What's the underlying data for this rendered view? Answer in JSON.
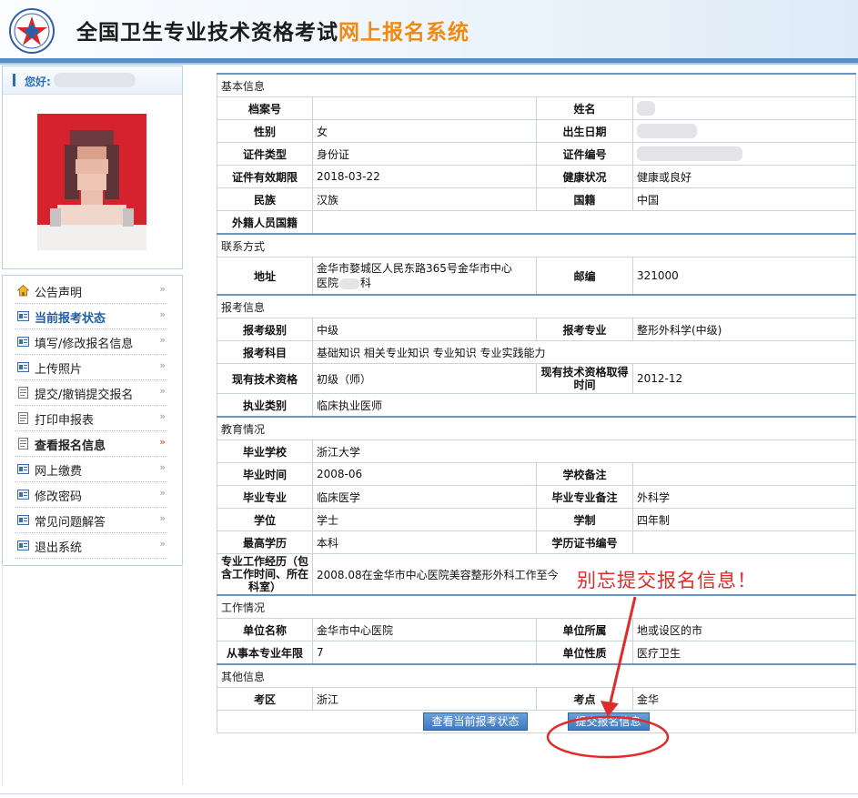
{
  "header": {
    "title_main": "全国卫生专业技术资格考试",
    "title_accent": "网上报名系统"
  },
  "sidebar": {
    "greeting": "您好:",
    "nav": [
      {
        "label": "公告声明",
        "icon": "home-icon"
      },
      {
        "label": "当前报考状态",
        "icon": "card-icon",
        "active": true
      },
      {
        "label": "填写/修改报名信息",
        "icon": "card-icon"
      },
      {
        "label": "上传照片",
        "icon": "card-icon"
      },
      {
        "label": "提交/撤销提交报名",
        "icon": "document-icon"
      },
      {
        "label": "打印申报表",
        "icon": "document-icon"
      },
      {
        "label": "查看报名信息",
        "icon": "document-icon",
        "current": true
      },
      {
        "label": "网上缴费",
        "icon": "card-icon"
      },
      {
        "label": "修改密码",
        "icon": "card-icon"
      },
      {
        "label": "常见问题解答",
        "icon": "card-icon"
      },
      {
        "label": "退出系统",
        "icon": "card-icon"
      }
    ]
  },
  "form": {
    "basic": {
      "title": "基本信息",
      "archive_no_label": "档案号",
      "archive_no": "",
      "name_label": "姓名",
      "gender_label": "性别",
      "gender": "女",
      "birth_label": "出生日期",
      "id_type_label": "证件类型",
      "id_type": "身份证",
      "id_no_label": "证件编号",
      "id_valid_label": "证件有效期限",
      "id_valid": "2018-03-22",
      "health_label": "健康状况",
      "health": "健康或良好",
      "ethnicity_label": "民族",
      "ethnicity": "汉族",
      "nationality_label": "国籍",
      "nationality": "中国",
      "foreign_label": "外籍人员国籍",
      "foreign": ""
    },
    "contact": {
      "title": "联系方式",
      "address_label": "地址",
      "address_line1": "金华市婺城区人民东路365号金华市中心",
      "address_line2a": "医院",
      "address_line2b": "科",
      "postcode_label": "邮编",
      "postcode": "321000"
    },
    "exam": {
      "title": "报考信息",
      "level_label": "报考级别",
      "level": "中级",
      "specialty_label": "报考专业",
      "specialty": "整形外科学(中级)",
      "subjects_label": "报考科目",
      "subjects": "基础知识 相关专业知识 专业知识 专业实践能力",
      "current_qual_label": "现有技术资格",
      "current_qual": "初级（师）",
      "qual_time_label": "现有技术资格取得时间",
      "qual_time": "2012-12",
      "practice_label": "执业类别",
      "practice": "临床执业医师"
    },
    "education": {
      "title": "教育情况",
      "school_label": "毕业学校",
      "school": "浙江大学",
      "grad_time_label": "毕业时间",
      "grad_time": "2008-06",
      "school_note_label": "学校备注",
      "school_note": "",
      "major_label": "毕业专业",
      "major": "临床医学",
      "major_note_label": "毕业专业备注",
      "major_note": "外科学",
      "degree_label": "学位",
      "degree": "学士",
      "duration_label": "学制",
      "duration": "四年制",
      "highest_label": "最高学历",
      "highest": "本科",
      "cert_label": "学历证书编号",
      "cert": "",
      "experience_label": "专业工作经历（包含工作时间、所在科室）",
      "experience": "2008.08在金华市中心医院美容整形外科工作至今"
    },
    "work": {
      "title": "工作情况",
      "unit_label": "单位名称",
      "unit": "金华市中心医院",
      "unit_loc_label": "单位所属",
      "unit_loc": "地或设区的市",
      "years_label": "从事本专业年限",
      "years": "7",
      "unit_type_label": "单位性质",
      "unit_type": "医疗卫生"
    },
    "other": {
      "title": "其他信息",
      "district_label": "考区",
      "district": "浙江",
      "site_label": "考点",
      "site": "金华"
    }
  },
  "buttons": {
    "view_status": "查看当前报考状态",
    "submit": "提交报名信息"
  },
  "annotation": {
    "text": "别忘提交报名信息！",
    "color": "#e02b2b"
  },
  "colors": {
    "brand_blue": "#2b6fba",
    "accent_orange": "#f08a12",
    "section_line": "#6c95c2"
  }
}
